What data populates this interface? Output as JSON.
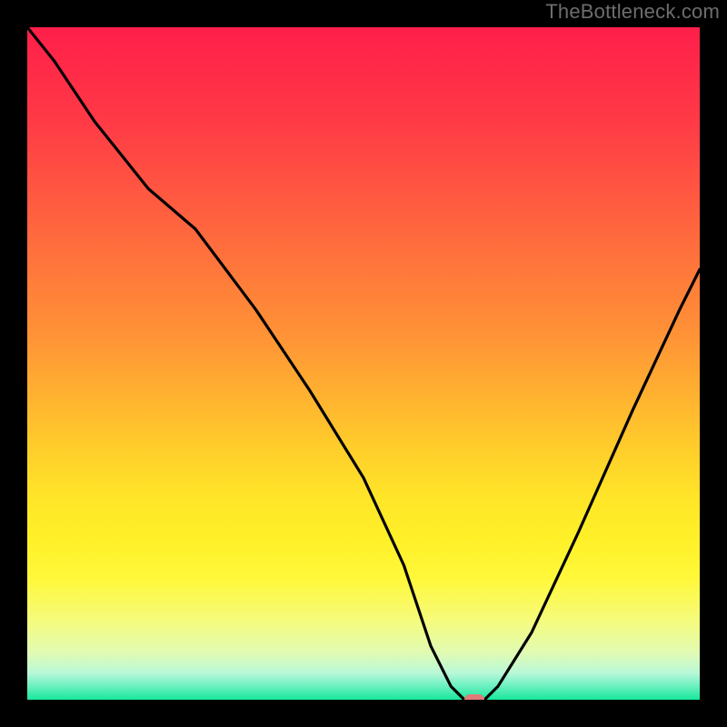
{
  "watermark": "TheBottleneck.com",
  "chart_data": {
    "type": "line",
    "title": "",
    "xlabel": "",
    "ylabel": "",
    "xlim": [
      0,
      100
    ],
    "ylim": [
      0,
      100
    ],
    "grid": false,
    "legend": false,
    "background_gradient": {
      "top": "#ff1f4a",
      "bottom": "#17e89b",
      "description": "red to orange to yellow to green vertical gradient"
    },
    "series": [
      {
        "name": "bottleneck-curve",
        "color": "#000000",
        "x": [
          0,
          4,
          10,
          18,
          25,
          34,
          42,
          50,
          56,
          60,
          63,
          65,
          68,
          70,
          75,
          82,
          90,
          97,
          100
        ],
        "values": [
          100,
          95,
          86,
          76,
          70,
          58,
          46,
          33,
          20,
          8,
          2,
          0,
          0,
          2,
          10,
          25,
          43,
          58,
          64
        ]
      }
    ],
    "marker": {
      "x": 66.5,
      "y": 0,
      "color": "#e07a78"
    }
  }
}
